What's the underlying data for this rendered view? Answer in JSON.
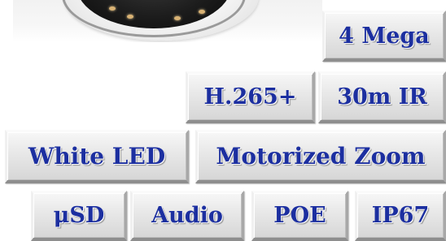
{
  "colors": {
    "text": "#1c2fa0",
    "badge_face": "#e4e4e4",
    "badge_shadow": "#8e8e8e",
    "background": "#ffffff"
  },
  "image": {
    "subject": "dome-camera",
    "icon": "dome-camera-icon"
  },
  "badges": {
    "mega": "4 Mega",
    "codec": "H.265+",
    "ir": "30m IR",
    "white_led": "White LED",
    "zoom": "Motorized Zoom",
    "sd": "μSD",
    "audio": "Audio",
    "poe": "POE",
    "ip": "IP67"
  }
}
